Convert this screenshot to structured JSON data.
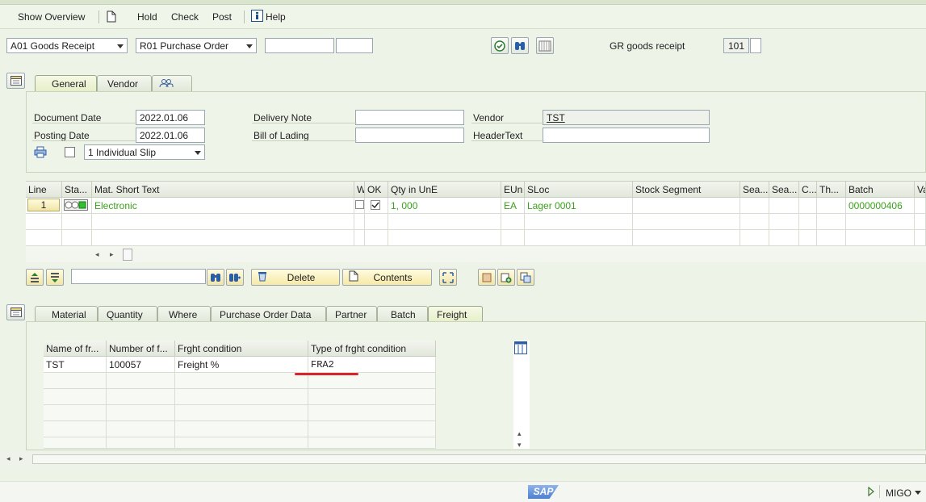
{
  "toolbar": {
    "show_overview": "Show Overview",
    "hold": "Hold",
    "check": "Check",
    "post": "Post",
    "help": "Help"
  },
  "selection": {
    "action": "A01 Goods Receipt",
    "reference": "R01 Purchase Order",
    "movement_label": "GR goods receipt",
    "movement_type": "101"
  },
  "header_tabs": [
    "General",
    "Vendor"
  ],
  "header": {
    "document_date_label": "Document Date",
    "document_date": "2022.01.06",
    "posting_date_label": "Posting Date",
    "posting_date": "2022.01.06",
    "slip": "1 Individual Slip",
    "delivery_note_label": "Delivery Note",
    "bill_of_lading_label": "Bill of Lading",
    "vendor_label": "Vendor",
    "vendor": "TST",
    "header_text_label": "HeaderText"
  },
  "item_grid": {
    "columns": [
      "Line",
      "Sta...",
      "Mat. Short Text",
      "W",
      "OK",
      "Qty in UnE",
      "EUn",
      "SLoc",
      "Stock Segment",
      "Sea...",
      "Sea...",
      "C...",
      "Th...",
      "Batch",
      "Va"
    ],
    "rows": [
      {
        "line": "1",
        "text": "Electronic",
        "qty": "1, 000",
        "eun": "EA",
        "sloc": "Lager 0001",
        "batch": "0000000406"
      }
    ]
  },
  "item_buttons": {
    "delete": "Delete",
    "contents": "Contents"
  },
  "detail_tabs": [
    "Material",
    "Quantity",
    "Where",
    "Purchase Order Data",
    "Partner",
    "Batch",
    "Freight"
  ],
  "freight_grid": {
    "columns": [
      "Name of fr...",
      "Number of f...",
      "Frght condition",
      "Type of frght condition"
    ],
    "rows": [
      {
        "name": "TST",
        "number": "100057",
        "condition": "Freight %",
        "type": "FRA2"
      }
    ]
  },
  "status": {
    "brand": "SAP",
    "transaction": "MIGO"
  },
  "colors": {
    "highlight": "#d8252a",
    "green_text": "#3aa21a"
  }
}
